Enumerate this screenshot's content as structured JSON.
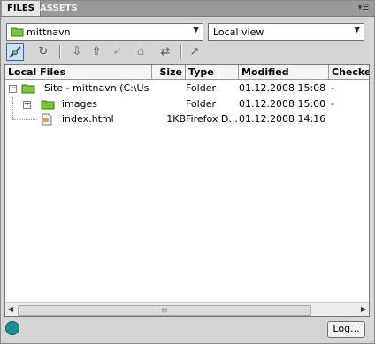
{
  "tabs": [
    {
      "label": "FILES",
      "active": true
    },
    {
      "label": "ASSETS",
      "active": false
    }
  ],
  "panel_menu_icon": "panel-options-icon",
  "site_select": {
    "value": "mittnavn",
    "icon": "folder-icon"
  },
  "view_select": {
    "value": "Local view"
  },
  "toolbar": [
    {
      "name": "connect-button",
      "icon": "connect-plug-icon",
      "glyph": "⌁"
    },
    {
      "name": "refresh-button",
      "icon": "refresh-icon",
      "glyph": "↻"
    },
    {
      "name": "get-files-button",
      "icon": "down-arrow-icon",
      "glyph": "⇩"
    },
    {
      "name": "put-files-button",
      "icon": "up-arrow-icon",
      "glyph": "⇧"
    },
    {
      "name": "check-out-button",
      "icon": "check-out-icon",
      "glyph": "✓"
    },
    {
      "name": "check-in-button",
      "icon": "check-in-icon",
      "glyph": "⌂"
    },
    {
      "name": "synchronize-button",
      "icon": "synchronize-icon",
      "glyph": "⇄"
    },
    {
      "name": "expand-button",
      "icon": "expand-icon",
      "glyph": "↗"
    }
  ],
  "columns": [
    "Local Files",
    "Size",
    "Type",
    "Modified",
    "Checked"
  ],
  "rows": [
    {
      "name": "Site - mittnavn (C:\\Us...",
      "size": "",
      "type": "Folder",
      "modified": "01.12.2008 15:08",
      "checked": "-"
    },
    {
      "name": "images",
      "size": "",
      "type": "Folder",
      "modified": "01.12.2008 15:00",
      "checked": "-"
    },
    {
      "name": "index.html",
      "size": "1KB",
      "type": "Firefox D...",
      "modified": "01.12.2008 14:16",
      "checked": ""
    }
  ],
  "expanders": [
    "−",
    "+"
  ],
  "scroll_thumb_grip": "III",
  "log_button": "Log...",
  "colors": {
    "tab_bar": "#9a9a9a",
    "folder_green": "#7cc43a",
    "accent_blue": "#3f6aa7"
  }
}
